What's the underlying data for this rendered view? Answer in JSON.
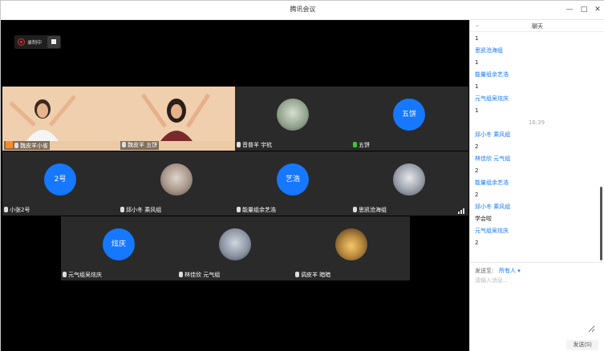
{
  "window": {
    "title": "腾讯会议",
    "minimize": "—",
    "maximize": "□",
    "close": "✕"
  },
  "recording": {
    "label": "录制中"
  },
  "participants": [
    {
      "name": "魏皮羊小雀",
      "kind": "photo",
      "host": true
    },
    {
      "name": "魏皮羊 五饼",
      "kind": "photo"
    },
    {
      "name": "音普羊 宇杭",
      "kind": "avatar-photo"
    },
    {
      "name": "五饼",
      "kind": "initials",
      "initials": "五饼"
    },
    {
      "name": "小张2号",
      "kind": "initials",
      "initials": "2号"
    },
    {
      "name": "邱小冬 乘风组",
      "kind": "avatar-photo"
    },
    {
      "name": "能量组余艺浩",
      "kind": "initials",
      "initials": "艺浩"
    },
    {
      "name": "思凯沧海组",
      "kind": "avatar-photo",
      "signal": true
    },
    {
      "name": "元气组吴炫庆",
      "kind": "initials",
      "initials": "炫庆"
    },
    {
      "name": "林佳欣 元气组",
      "kind": "avatar-photo"
    },
    {
      "name": "调皮羊 暗暗",
      "kind": "avatar-photo"
    }
  ],
  "chat": {
    "title": "聊天",
    "collapse": "⌄",
    "messages": [
      {
        "type": "text",
        "value": "1"
      },
      {
        "type": "sender",
        "value": "思凯沧海组"
      },
      {
        "type": "text",
        "value": "1"
      },
      {
        "type": "sender",
        "value": "能量组余艺浩"
      },
      {
        "type": "text",
        "value": "1"
      },
      {
        "type": "sender",
        "value": "元气组吴炫庆"
      },
      {
        "type": "text",
        "value": "1"
      },
      {
        "type": "time",
        "value": "16:39"
      },
      {
        "type": "sender",
        "value": "邱小冬 乘风组"
      },
      {
        "type": "text",
        "value": "2"
      },
      {
        "type": "sender",
        "value": "林佳欣 元气组"
      },
      {
        "type": "text",
        "value": "2"
      },
      {
        "type": "sender",
        "value": "能量组余艺浩"
      },
      {
        "type": "text",
        "value": "2"
      },
      {
        "type": "sender",
        "value": "邱小冬 乘风组"
      },
      {
        "type": "text",
        "value": "学会啦"
      },
      {
        "type": "sender",
        "value": "元气组吴炫庆"
      },
      {
        "type": "text",
        "value": "2"
      }
    ],
    "send_to_label": "发送至:",
    "send_to_value": "所有人 ▾",
    "input_placeholder": "请输入消息...",
    "send_button": "发送(S)"
  }
}
